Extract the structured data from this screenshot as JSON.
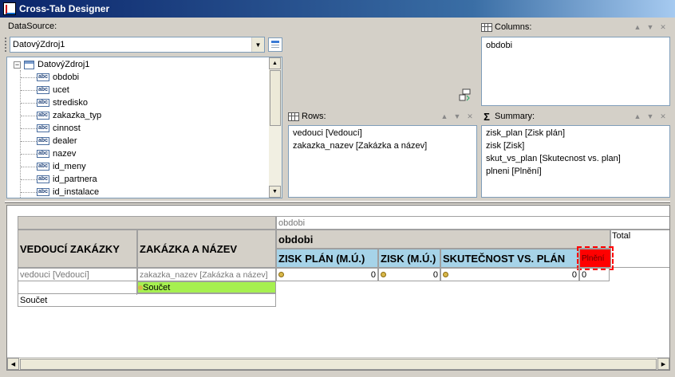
{
  "window": {
    "title": "Cross-Tab Designer"
  },
  "datasource": {
    "label": "DataSource:",
    "selected": "DatovýZdroj1",
    "tree_root": "DatovýZdroj1",
    "fields": [
      "obdobi",
      "ucet",
      "stredisko",
      "zakazka_typ",
      "cinnost",
      "dealer",
      "nazev",
      "id_meny",
      "id_partnera",
      "id_instalace"
    ],
    "field_icon_text": "abc"
  },
  "columns_pane": {
    "title": "Columns:",
    "items": [
      "obdobi"
    ]
  },
  "rows_pane": {
    "title": "Rows:",
    "items": [
      "vedouci [Vedoucí]",
      "zakazka_nazev [Zakázka a název]"
    ]
  },
  "summary_pane": {
    "title": "Summary:",
    "items": [
      "zisk_plan [Zisk plán]",
      "zisk [Zisk]",
      "skut_vs_plan [Skutecnost vs. plan]",
      "plneni [Plnění]"
    ]
  },
  "crosstab": {
    "col_field_header": "obdobi",
    "row_header_1": "VEDOUCÍ ZAKÁZKY",
    "row_header_2": "ZAKÁZKA A NÁZEV",
    "col_value": "obdobi",
    "measures": [
      "ZISK PLÁN (M.Ú.)",
      "ZISK (M.Ú.)",
      "SKUTEČNOST VS. PLÁN",
      "Plnění"
    ],
    "total_label": "Total",
    "row_field_1": "vedouci [Vedoucí]",
    "row_field_2": "zakazka_nazev [Zakázka a název]",
    "values": [
      "0",
      "0",
      "0",
      "0"
    ],
    "subtotal_label": "Součet",
    "grand_total_label": "Součet"
  },
  "colors": {
    "selected_cell": "#ff0000",
    "subtotal_cell": "#a6f050",
    "measure_header": "#a6d3e8"
  }
}
